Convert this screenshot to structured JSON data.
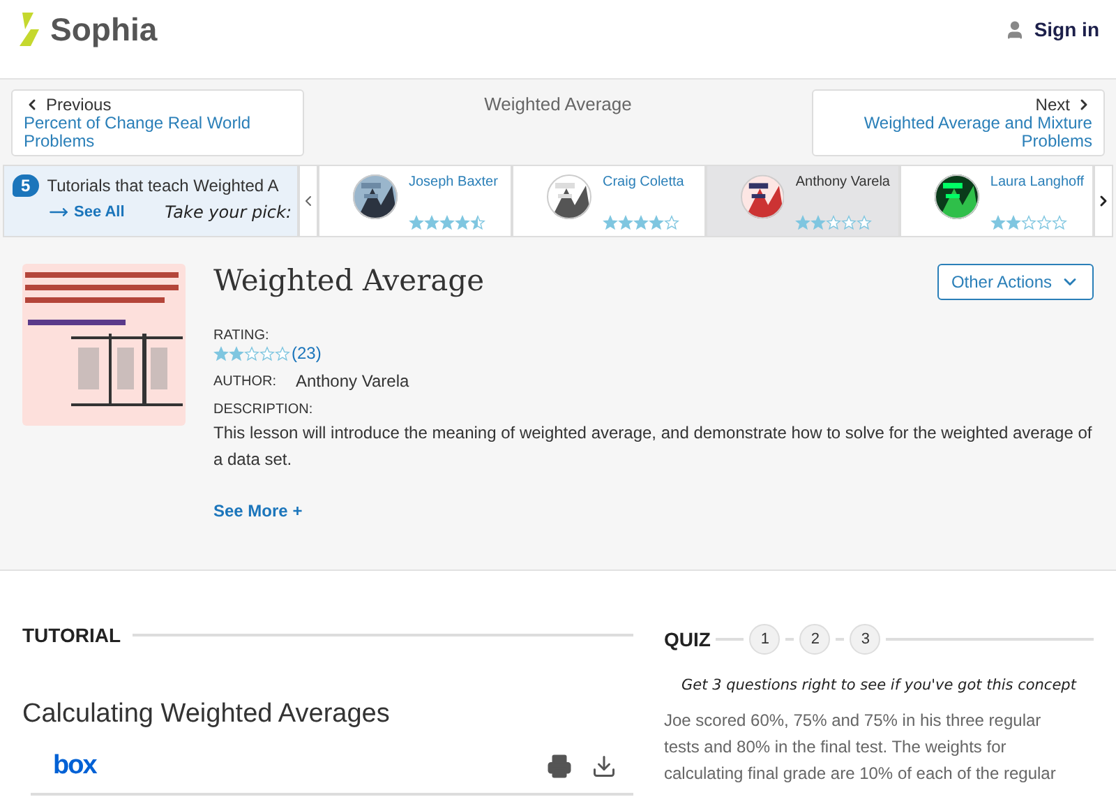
{
  "header": {
    "logo": "Sophia",
    "sign_in": "Sign in"
  },
  "nav": {
    "previous_label": "Previous",
    "previous_title": "Percent of Change Real World Problems",
    "current": "Weighted Average",
    "next_label": "Next",
    "next_title": "Weighted Average and Mixture Problems"
  },
  "tutors_strip": {
    "count": "5",
    "heading": "Tutorials that teach Weighted A",
    "see_all": "See All",
    "tagline": "Take your pick:",
    "tutors": [
      {
        "name": "Joseph Baxter",
        "stars": 4.5,
        "selected": false
      },
      {
        "name": "Craig Coletta",
        "stars": 4,
        "selected": false
      },
      {
        "name": "Anthony Varela",
        "stars": 2,
        "selected": true
      },
      {
        "name": "Laura Langhoff",
        "stars": 2,
        "selected": false
      }
    ]
  },
  "lesson": {
    "title": "Weighted Average",
    "other_actions": "Other Actions",
    "rating_label": "RATING:",
    "stars": 2,
    "rating_count": "(23)",
    "author_label": "AUTHOR:",
    "author": "Anthony Varela",
    "description_label": "DESCRIPTION:",
    "description": "This lesson will introduce the meaning of weighted average, and demonstrate how to solve for the weighted average of a data set.",
    "see_more": "See More +"
  },
  "tutorial": {
    "heading": "TUTORIAL",
    "title": "Calculating Weighted Averages",
    "viewer_logo": "box"
  },
  "quiz": {
    "heading": "QUIZ",
    "steps": [
      "1",
      "2",
      "3"
    ],
    "tagline": "Get 3 questions right to see if you've got this concept",
    "question": "Joe scored 60%, 75% and 75% in his three regular tests and 80% in the final test. The weights for calculating final grade are 10% of each of the regular"
  }
}
